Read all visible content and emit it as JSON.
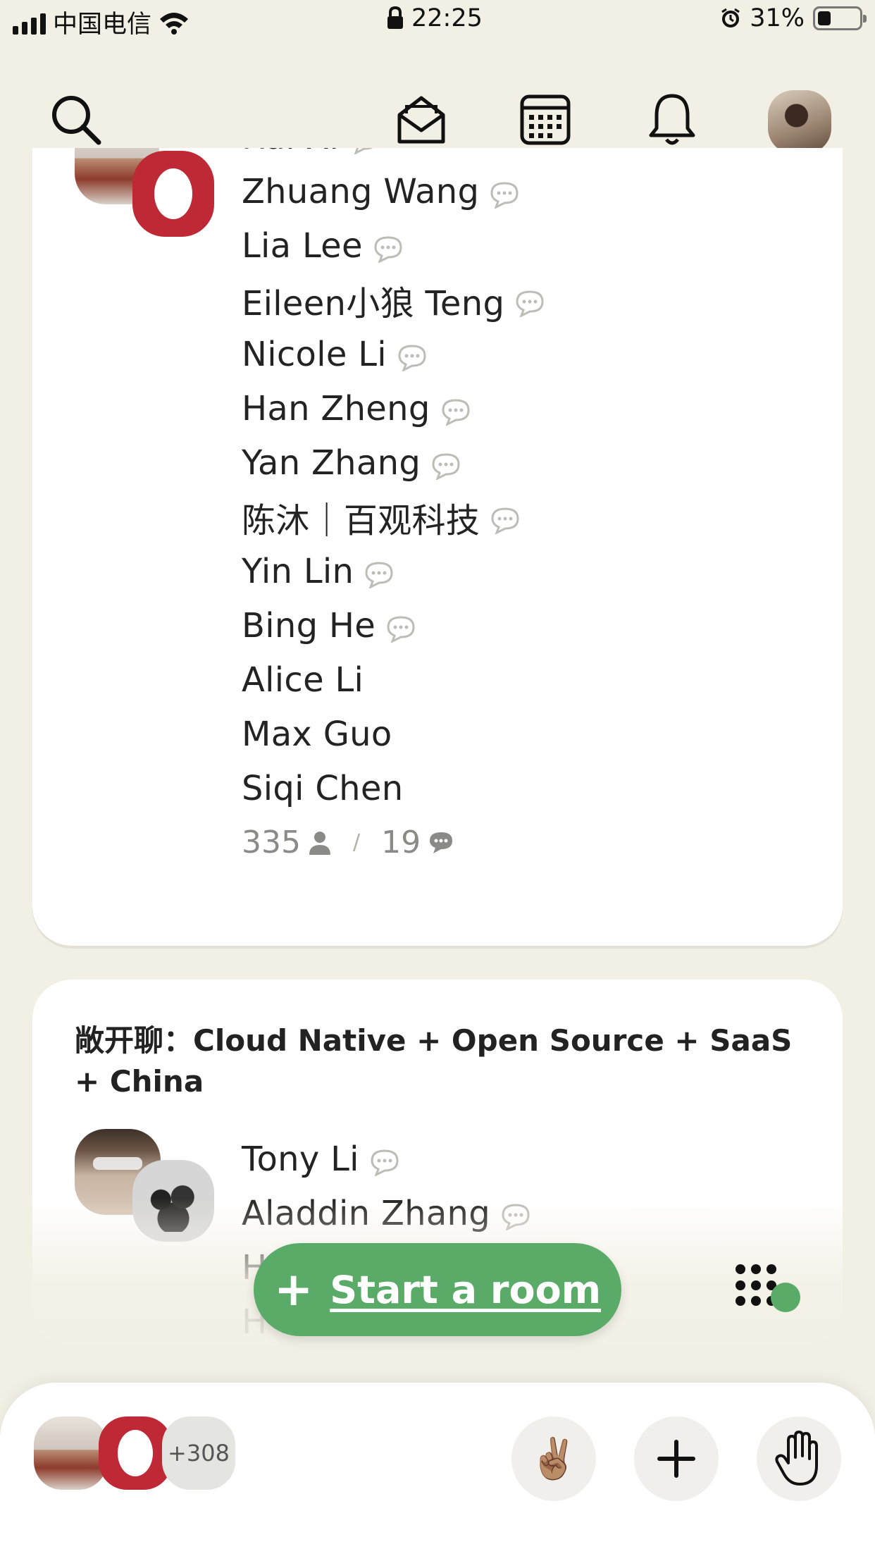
{
  "status_bar": {
    "carrier": "中国电信",
    "time": "22:25",
    "battery": "31%"
  },
  "nav": {
    "icons": [
      "search-icon",
      "invite-envelope-icon",
      "calendar-icon",
      "notifications-bell-icon",
      "profile-avatar"
    ]
  },
  "room1": {
    "speakers": [
      {
        "name": "Rui Xi",
        "chat": true
      },
      {
        "name": "Zhuang Wang",
        "chat": true
      },
      {
        "name": "Lia Lee",
        "chat": true
      },
      {
        "name": "Eileen小狼 Teng",
        "chat": true
      },
      {
        "name": "Nicole Li",
        "chat": true
      },
      {
        "name": "Han Zheng",
        "chat": true
      },
      {
        "name": "Yan Zhang",
        "chat": true
      },
      {
        "name": "陈沐｜百观科技",
        "chat": true
      },
      {
        "name": "Yin Lin",
        "chat": true
      },
      {
        "name": "Bing He",
        "chat": true
      },
      {
        "name": "Alice Li",
        "chat": false
      },
      {
        "name": "Max Guo",
        "chat": false
      },
      {
        "name": "Siqi Chen",
        "chat": false
      }
    ],
    "listener_count": "335",
    "separator": "/",
    "speaker_count": "19"
  },
  "room2": {
    "title": "敞开聊：Cloud Native + Open Source + SaaS + China",
    "speakers": [
      {
        "name": "Tony Li",
        "chat": true
      },
      {
        "name": "Aladdin Zhang",
        "chat": true
      },
      {
        "name": "H",
        "chat": false
      },
      {
        "name": "H",
        "chat": false
      }
    ]
  },
  "start_room": {
    "label": "Start a room"
  },
  "bottom_bar": {
    "more_count": "+308",
    "peace_emoji": "✌🏽",
    "hand_emoji": "✋"
  },
  "colors": {
    "background": "#f2efe4",
    "accent_green": "#5aab68",
    "opera_red": "#bf2935"
  }
}
